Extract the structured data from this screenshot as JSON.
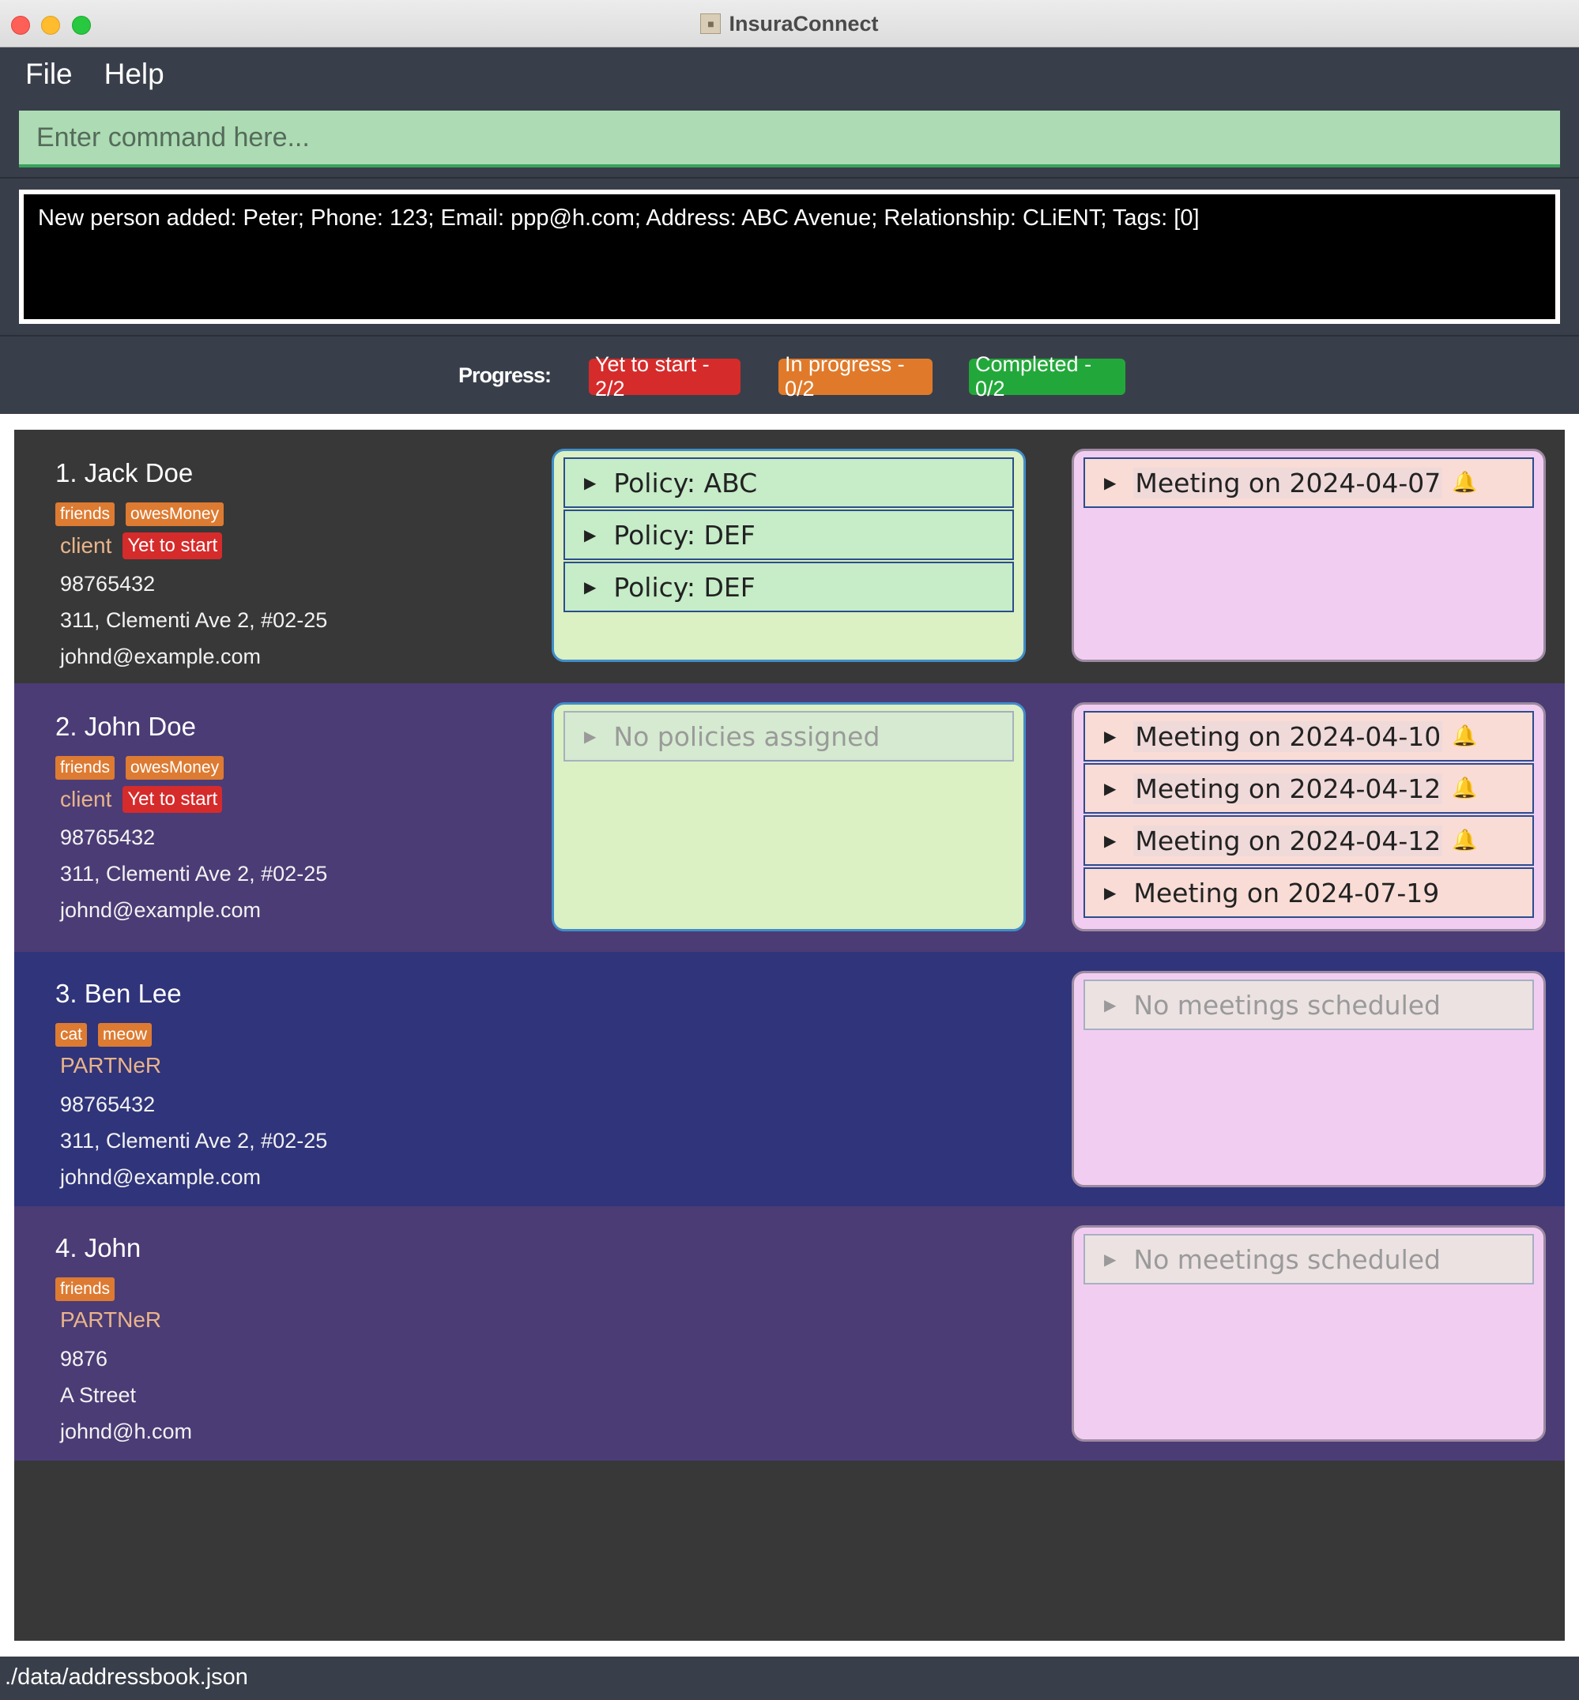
{
  "window": {
    "title": "InsuraConnect"
  },
  "menu": {
    "file": "File",
    "help": "Help"
  },
  "command": {
    "placeholder": "Enter command here..."
  },
  "result": {
    "text": "New person added: Peter; Phone: 123; Email: ppp@h.com; Address: ABC Avenue; Relationship: CLiENT; Tags: [0]"
  },
  "progress": {
    "label": "Progress:",
    "yet_to_start": "Yet to start - 2/2",
    "in_progress": "In progress - 0/2",
    "completed": "Completed - 0/2",
    "colors": {
      "yet_to_start": "#d62b2b",
      "in_progress": "#e07a2a",
      "completed": "#22a83a"
    }
  },
  "persons": [
    {
      "name": "1.  Jack Doe",
      "tags": [
        "friends",
        "owesMoney"
      ],
      "relationship": "client",
      "status": "Yet to start",
      "phone": "98765432",
      "address": "311, Clementi Ave 2, #02-25",
      "email": "johnd@example.com",
      "policies": [
        "Policy: ABC",
        "Policy: DEF",
        "Policy: DEF"
      ],
      "meetings": [
        "Meeting on 2024-04-07"
      ]
    },
    {
      "name": "2.  John Doe",
      "tags": [
        "friends",
        "owesMoney"
      ],
      "relationship": "client",
      "status": "Yet to start",
      "phone": "98765432",
      "address": "311, Clementi Ave 2, #02-25",
      "email": "johnd@example.com",
      "policies_empty": "No policies assigned",
      "meetings": [
        "Meeting on 2024-04-10",
        "Meeting on 2024-04-12",
        "Meeting on 2024-04-12",
        "Meeting on 2024-07-19"
      ]
    },
    {
      "name": "3.  Ben Lee",
      "tags": [
        "cat",
        "meow"
      ],
      "relationship": "PARTNeR",
      "phone": "98765432",
      "address": "311, Clementi Ave 2, #02-25",
      "email": "johnd@example.com",
      "meetings_empty": "No meetings scheduled"
    },
    {
      "name": "4.  John",
      "tags": [
        "friends"
      ],
      "relationship": "PARTNeR",
      "phone": "9876",
      "address": "A Street",
      "email": "johnd@h.com",
      "meetings_empty": "No meetings scheduled"
    }
  ],
  "icons": {
    "expand": "triangle-right-icon",
    "reminder": "bell-icon",
    "app": "app-icon"
  },
  "statusbar": {
    "path": "./data/addressbook.json"
  }
}
